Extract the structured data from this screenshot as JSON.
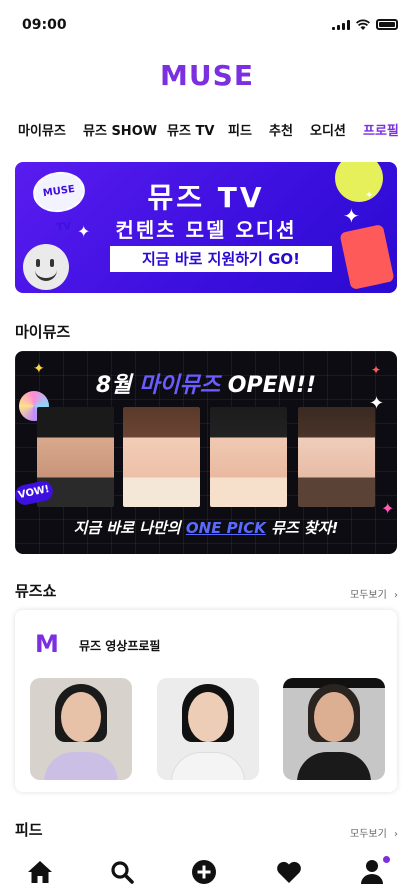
{
  "status_bar": {
    "time": "09:00"
  },
  "app": {
    "logo": "MUSE"
  },
  "tabs": [
    {
      "label": "마이뮤즈"
    },
    {
      "label": "뮤즈 SHOW"
    },
    {
      "label": "뮤즈 TV"
    },
    {
      "label": "피드"
    },
    {
      "label": "추천"
    },
    {
      "label": "오디션"
    },
    {
      "label": "프로필"
    }
  ],
  "banner": {
    "title_line1": "뮤즈 TV",
    "title_line2": "컨텐츠 모델 오디션",
    "cta": "지금 바로 지원하기 GO!",
    "sticker_text": "MUSE TV",
    "colors": {
      "background": "#3d10e0",
      "accent_yellow": "#e6f05a"
    }
  },
  "my_muse": {
    "section_title": "마이뮤즈",
    "banner_headline_pre": "8월 ",
    "banner_headline_highlight": "마이뮤즈",
    "banner_headline_post": " OPEN!!",
    "banner_sub_pre": "지금 바로 나만의 ",
    "banner_sub_highlight": "ONE PICK",
    "banner_sub_post": " 뮤즈 찾자!",
    "badge": "VOW!"
  },
  "muse_show": {
    "section_title": "뮤즈쇼",
    "more_label": "모두보기",
    "card_logo": "M",
    "card_label": "뮤즈 영상프로필"
  },
  "feed": {
    "section_title": "피드",
    "more_label": "모두보기"
  },
  "bottom_nav": [
    {
      "icon": "home-icon"
    },
    {
      "icon": "search-icon"
    },
    {
      "icon": "add-circle-icon"
    },
    {
      "icon": "heart-icon"
    },
    {
      "icon": "user-icon"
    }
  ],
  "theme": {
    "brand": "#7b2fe0",
    "text": "#111111"
  }
}
